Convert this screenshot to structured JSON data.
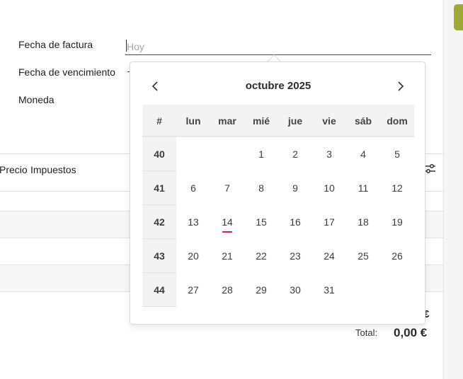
{
  "form": {
    "invoice_date_label": "Fecha de factura",
    "invoice_date_placeholder": "Hoy",
    "due_date_label": "Fecha de vencimiento",
    "currency_label": "Moneda"
  },
  "table": {
    "price_header": "Precio",
    "taxes_header": "Impuestos"
  },
  "totals": {
    "partial_symbol": "€",
    "total_label": "Total:",
    "total_value": "0,00 €"
  },
  "calendar": {
    "month_title": "octubre 2025",
    "week_header": "#",
    "weekdays": [
      "lun",
      "mar",
      "mié",
      "jue",
      "vie",
      "sáb",
      "dom"
    ],
    "weeks": [
      {
        "week": "40",
        "days": [
          "",
          "",
          "1",
          "2",
          "3",
          "4",
          "5"
        ]
      },
      {
        "week": "41",
        "days": [
          "6",
          "7",
          "8",
          "9",
          "10",
          "11",
          "12"
        ]
      },
      {
        "week": "42",
        "days": [
          "13",
          "14",
          "15",
          "16",
          "17",
          "18",
          "19"
        ]
      },
      {
        "week": "43",
        "days": [
          "20",
          "21",
          "22",
          "23",
          "24",
          "25",
          "26"
        ]
      },
      {
        "week": "44",
        "days": [
          "27",
          "28",
          "29",
          "30",
          "31",
          "",
          ""
        ]
      }
    ],
    "today": "14",
    "today_marker_color": "#d11f44"
  },
  "icons": {
    "prev": "chevron-left-icon",
    "next": "chevron-right-icon",
    "column_settings": "sliders-icon"
  },
  "colors": {
    "accent_tab": "#9ea93a"
  }
}
